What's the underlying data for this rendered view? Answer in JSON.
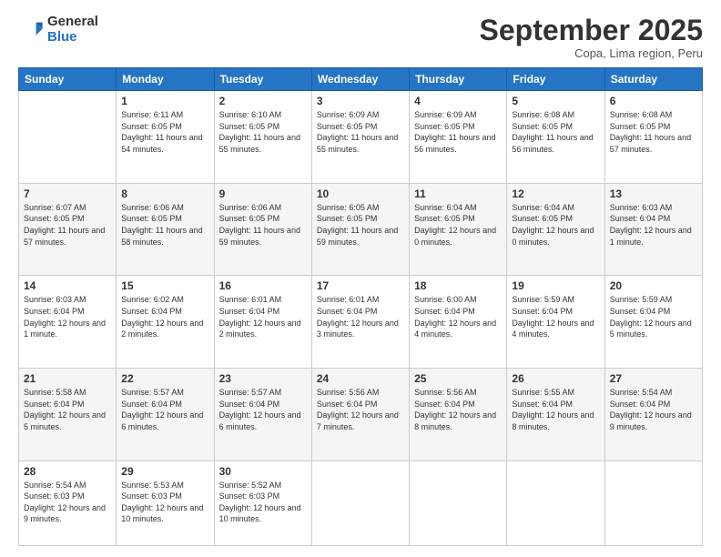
{
  "logo": {
    "general": "General",
    "blue": "Blue"
  },
  "title": "September 2025",
  "location": "Copa, Lima region, Peru",
  "weekdays": [
    "Sunday",
    "Monday",
    "Tuesday",
    "Wednesday",
    "Thursday",
    "Friday",
    "Saturday"
  ],
  "weeks": [
    [
      {
        "day": "",
        "empty": true
      },
      {
        "day": "1",
        "sunrise": "6:11 AM",
        "sunset": "6:05 PM",
        "daylight": "11 hours and 54 minutes."
      },
      {
        "day": "2",
        "sunrise": "6:10 AM",
        "sunset": "6:05 PM",
        "daylight": "11 hours and 55 minutes."
      },
      {
        "day": "3",
        "sunrise": "6:09 AM",
        "sunset": "6:05 PM",
        "daylight": "11 hours and 55 minutes."
      },
      {
        "day": "4",
        "sunrise": "6:09 AM",
        "sunset": "6:05 PM",
        "daylight": "11 hours and 56 minutes."
      },
      {
        "day": "5",
        "sunrise": "6:08 AM",
        "sunset": "6:05 PM",
        "daylight": "11 hours and 56 minutes."
      },
      {
        "day": "6",
        "sunrise": "6:08 AM",
        "sunset": "6:05 PM",
        "daylight": "11 hours and 57 minutes."
      }
    ],
    [
      {
        "day": "7",
        "sunrise": "6:07 AM",
        "sunset": "6:05 PM",
        "daylight": "11 hours and 57 minutes."
      },
      {
        "day": "8",
        "sunrise": "6:06 AM",
        "sunset": "6:05 PM",
        "daylight": "11 hours and 58 minutes."
      },
      {
        "day": "9",
        "sunrise": "6:06 AM",
        "sunset": "6:05 PM",
        "daylight": "11 hours and 59 minutes."
      },
      {
        "day": "10",
        "sunrise": "6:05 AM",
        "sunset": "6:05 PM",
        "daylight": "11 hours and 59 minutes."
      },
      {
        "day": "11",
        "sunrise": "6:04 AM",
        "sunset": "6:05 PM",
        "daylight": "12 hours and 0 minutes."
      },
      {
        "day": "12",
        "sunrise": "6:04 AM",
        "sunset": "6:05 PM",
        "daylight": "12 hours and 0 minutes."
      },
      {
        "day": "13",
        "sunrise": "6:03 AM",
        "sunset": "6:04 PM",
        "daylight": "12 hours and 1 minute."
      }
    ],
    [
      {
        "day": "14",
        "sunrise": "6:03 AM",
        "sunset": "6:04 PM",
        "daylight": "12 hours and 1 minute."
      },
      {
        "day": "15",
        "sunrise": "6:02 AM",
        "sunset": "6:04 PM",
        "daylight": "12 hours and 2 minutes."
      },
      {
        "day": "16",
        "sunrise": "6:01 AM",
        "sunset": "6:04 PM",
        "daylight": "12 hours and 2 minutes."
      },
      {
        "day": "17",
        "sunrise": "6:01 AM",
        "sunset": "6:04 PM",
        "daylight": "12 hours and 3 minutes."
      },
      {
        "day": "18",
        "sunrise": "6:00 AM",
        "sunset": "6:04 PM",
        "daylight": "12 hours and 4 minutes."
      },
      {
        "day": "19",
        "sunrise": "5:59 AM",
        "sunset": "6:04 PM",
        "daylight": "12 hours and 4 minutes."
      },
      {
        "day": "20",
        "sunrise": "5:59 AM",
        "sunset": "6:04 PM",
        "daylight": "12 hours and 5 minutes."
      }
    ],
    [
      {
        "day": "21",
        "sunrise": "5:58 AM",
        "sunset": "6:04 PM",
        "daylight": "12 hours and 5 minutes."
      },
      {
        "day": "22",
        "sunrise": "5:57 AM",
        "sunset": "6:04 PM",
        "daylight": "12 hours and 6 minutes."
      },
      {
        "day": "23",
        "sunrise": "5:57 AM",
        "sunset": "6:04 PM",
        "daylight": "12 hours and 6 minutes."
      },
      {
        "day": "24",
        "sunrise": "5:56 AM",
        "sunset": "6:04 PM",
        "daylight": "12 hours and 7 minutes."
      },
      {
        "day": "25",
        "sunrise": "5:56 AM",
        "sunset": "6:04 PM",
        "daylight": "12 hours and 8 minutes."
      },
      {
        "day": "26",
        "sunrise": "5:55 AM",
        "sunset": "6:04 PM",
        "daylight": "12 hours and 8 minutes."
      },
      {
        "day": "27",
        "sunrise": "5:54 AM",
        "sunset": "6:04 PM",
        "daylight": "12 hours and 9 minutes."
      }
    ],
    [
      {
        "day": "28",
        "sunrise": "5:54 AM",
        "sunset": "6:03 PM",
        "daylight": "12 hours and 9 minutes."
      },
      {
        "day": "29",
        "sunrise": "5:53 AM",
        "sunset": "6:03 PM",
        "daylight": "12 hours and 10 minutes."
      },
      {
        "day": "30",
        "sunrise": "5:52 AM",
        "sunset": "6:03 PM",
        "daylight": "12 hours and 10 minutes."
      },
      {
        "day": "",
        "empty": true
      },
      {
        "day": "",
        "empty": true
      },
      {
        "day": "",
        "empty": true
      },
      {
        "day": "",
        "empty": true
      }
    ]
  ]
}
